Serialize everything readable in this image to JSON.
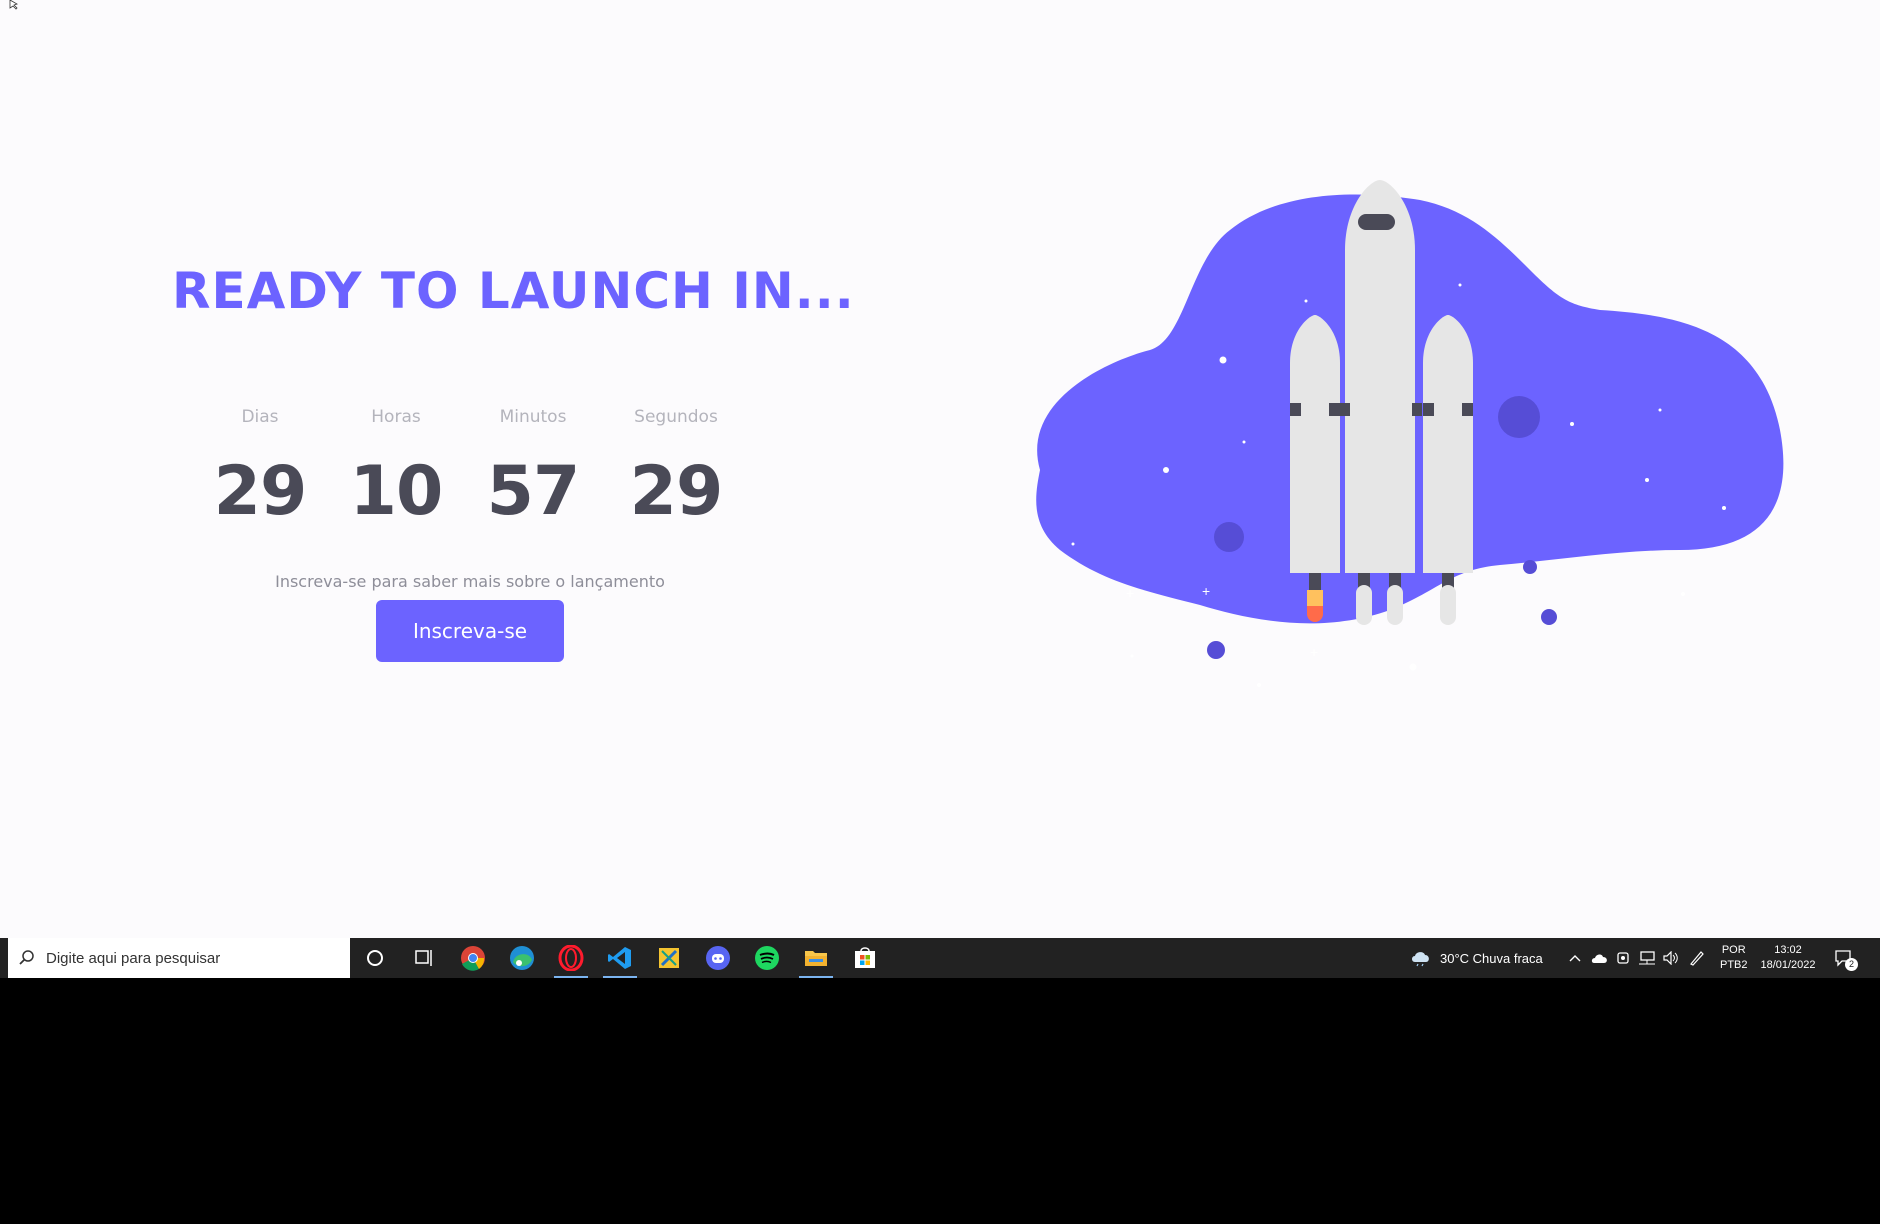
{
  "hero": {
    "headline": "READY TO LAUNCH IN...",
    "countdown": [
      {
        "label": "Dias",
        "value": "29"
      },
      {
        "label": "Horas",
        "value": "10"
      },
      {
        "label": "Minutos",
        "value": "57"
      },
      {
        "label": "Segundos",
        "value": "29"
      }
    ],
    "subtitle": "Inscreva-se para saber mais sobre o lançamento",
    "cta_label": "Inscreva-se"
  },
  "colors": {
    "accent": "#6c63ff",
    "number": "#4a4a57",
    "taskbar": "#222222"
  },
  "taskbar": {
    "search_placeholder": "Digite aqui para pesquisar",
    "apps": [
      "cortana-icon",
      "task-view-icon",
      "chrome-icon",
      "edge-icon",
      "opera-icon",
      "vscode-icon",
      "snip-icon",
      "discord-icon",
      "spotify-icon",
      "file-explorer-icon",
      "store-icon"
    ],
    "weather": "30°C  Chuva fraca",
    "language_top": "POR",
    "language_bottom": "PTB2",
    "time": "13:02",
    "date": "18/01/2022",
    "notification_count": "2"
  }
}
